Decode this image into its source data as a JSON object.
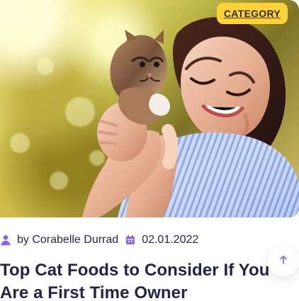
{
  "post": {
    "category": "CATEGORY",
    "author": "by Corabelle Durrad",
    "date": "02.01.2022",
    "title": "Top Cat Foods to Consider If You Are a First Time Owner"
  },
  "icons": {
    "author": "user-icon",
    "date": "calendar-icon",
    "scroll_top": "arrow-up-icon"
  },
  "colors": {
    "accent": "#ffd338",
    "icon": "#8a67e6",
    "title": "#222448",
    "meta": "#27284d"
  }
}
